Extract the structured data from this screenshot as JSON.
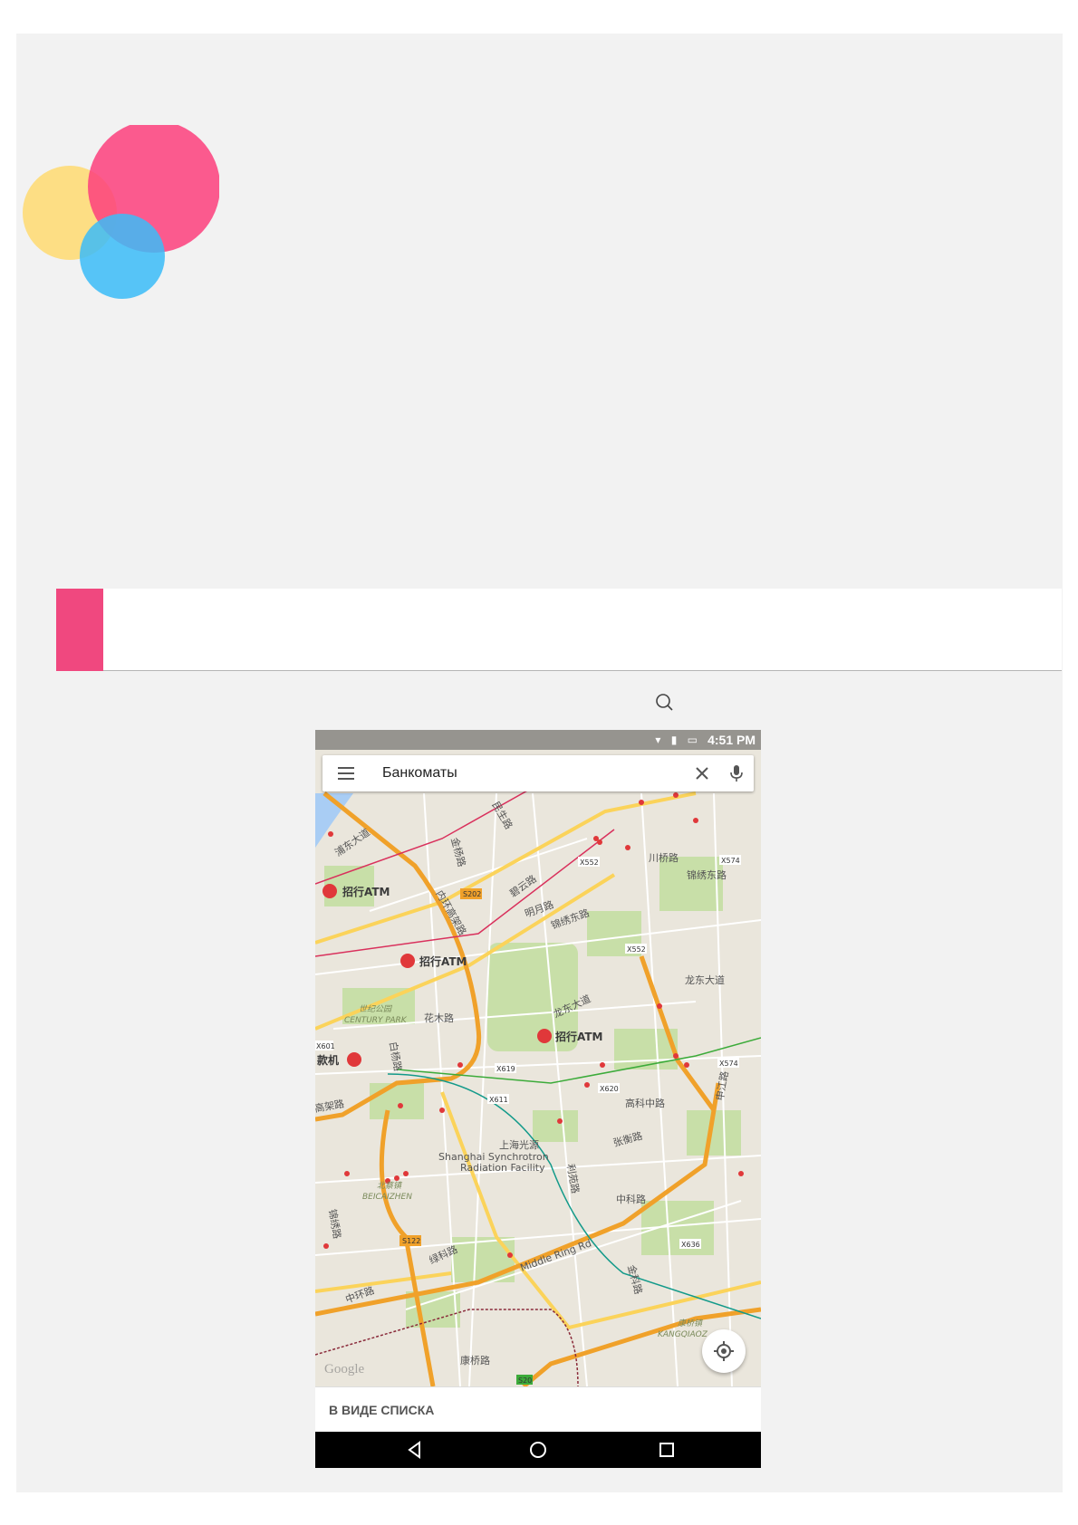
{
  "colors": {
    "page_background": "#f2f2f2",
    "chapter_accent": "#f0487f",
    "logo_pink": "#fd3f7d",
    "logo_yellow": "#fedc78",
    "logo_blue": "#3bbcf8"
  },
  "logo": {
    "icon": "overlapping-circles-logo"
  },
  "phone": {
    "status_bar": {
      "time": "4:51 PM"
    },
    "search": {
      "query": "Банкоматы"
    },
    "map": {
      "atm_markers": [
        "招行ATM",
        "招行ATM",
        "招行ATM",
        "款机"
      ],
      "road_labels": {
        "r1": "浦东大道",
        "r2": "内环高架路",
        "r3": "碧云路",
        "r4": "明月路",
        "r5": "锦绣东路",
        "r6": "川桥路",
        "r7": "锦绣东路",
        "r8": "龙东大道",
        "r9": "龙东大道",
        "r10": "花木路",
        "r11": "白杨路",
        "r12": "高科中路",
        "r13": "张衡路",
        "r14": "中科路",
        "r15": "绿科路",
        "r16": "中环路",
        "r17": "康桥路",
        "r18": "高架路",
        "r19": "申江路",
        "r20": "金科路",
        "r21": "Middle Ring Rd",
        "r22": "利苑路",
        "r23": "锦绣路",
        "r24": "金杨路",
        "r25": "民生路"
      },
      "road_badges": {
        "b1": "S202",
        "b2": "X552",
        "b3": "X574",
        "b4": "X552",
        "b5": "X619",
        "b6": "X611",
        "b7": "X620",
        "b8": "X574",
        "b9": "S122",
        "b10": "X636",
        "b11": "S20",
        "b12": "X601"
      },
      "places": {
        "century_park_cn": "世纪公园",
        "century_park_en": "CENTURY PARK",
        "synchrotron_cn": "上海光源",
        "synchrotron_en1": "Shanghai Synchrotron",
        "synchrotron_en2": "Radiation Facility",
        "beicaizhen_cn": "北蔡镇",
        "beicaizhen_en": "BEICAIZHEN",
        "kangqiao_cn": "康桥镇",
        "kangqiao_en": "KANGQIAOZ"
      },
      "attribution": "Google"
    },
    "list_view_label": "В ВИДЕ СПИСКА"
  }
}
